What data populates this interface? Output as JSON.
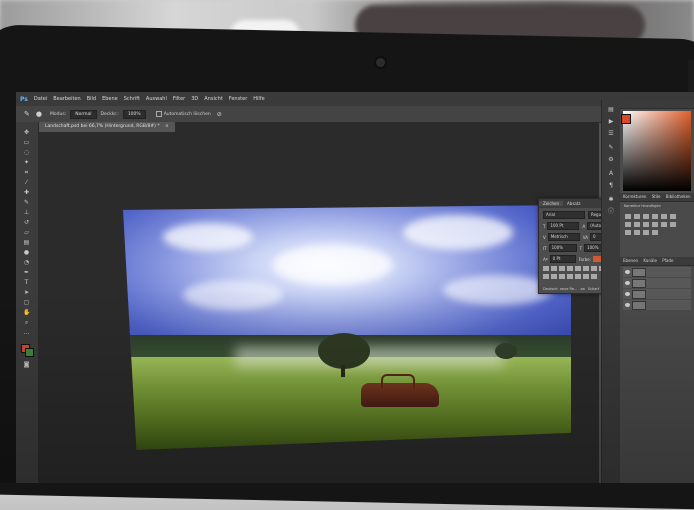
{
  "app": {
    "logo": "Ps",
    "menus": [
      "Datei",
      "Bearbeiten",
      "Bild",
      "Ebene",
      "Schrift",
      "Auswahl",
      "Filter",
      "3D",
      "Ansicht",
      "Fenster",
      "Hilfe"
    ]
  },
  "options_bar": {
    "mode_label": "Modus:",
    "mode_value": "Normal",
    "opacity_label": "Deckkr.:",
    "opacity_value": "100%",
    "auto_label": "Automatisch löschen"
  },
  "document": {
    "tab_label": "Landschaft.psd bei 66,7% (Hintergrund, RGB/8#) *"
  },
  "character_panel": {
    "tab_character": "Zeichen",
    "tab_paragraph": "Absatz",
    "font_family": "Arial",
    "font_style": "Regular",
    "font_size": "100 Pt",
    "leading": "(Auto)",
    "kerning": "Metrisch",
    "tracking": "0",
    "vscale": "100%",
    "hscale": "100%",
    "baseline": "0 Pt",
    "color_label": "Farbe:",
    "language": "Deutsch: neue Re...",
    "antialias": "Scharf"
  },
  "right_panels": {
    "adjustments_tab": "Korrekturen",
    "styles_tab": "Stile",
    "libraries_tab": "Bibliotheken",
    "adjust_hint": "Korrektur hinzufügen",
    "layers_tab": "Ebenen",
    "channels_tab": "Kanäle",
    "paths_tab": "Pfade"
  },
  "colors": {
    "foreground": "#d84a2a",
    "ui_dark": "#2b2b2b",
    "ui_panel": "#4a4a4a"
  }
}
